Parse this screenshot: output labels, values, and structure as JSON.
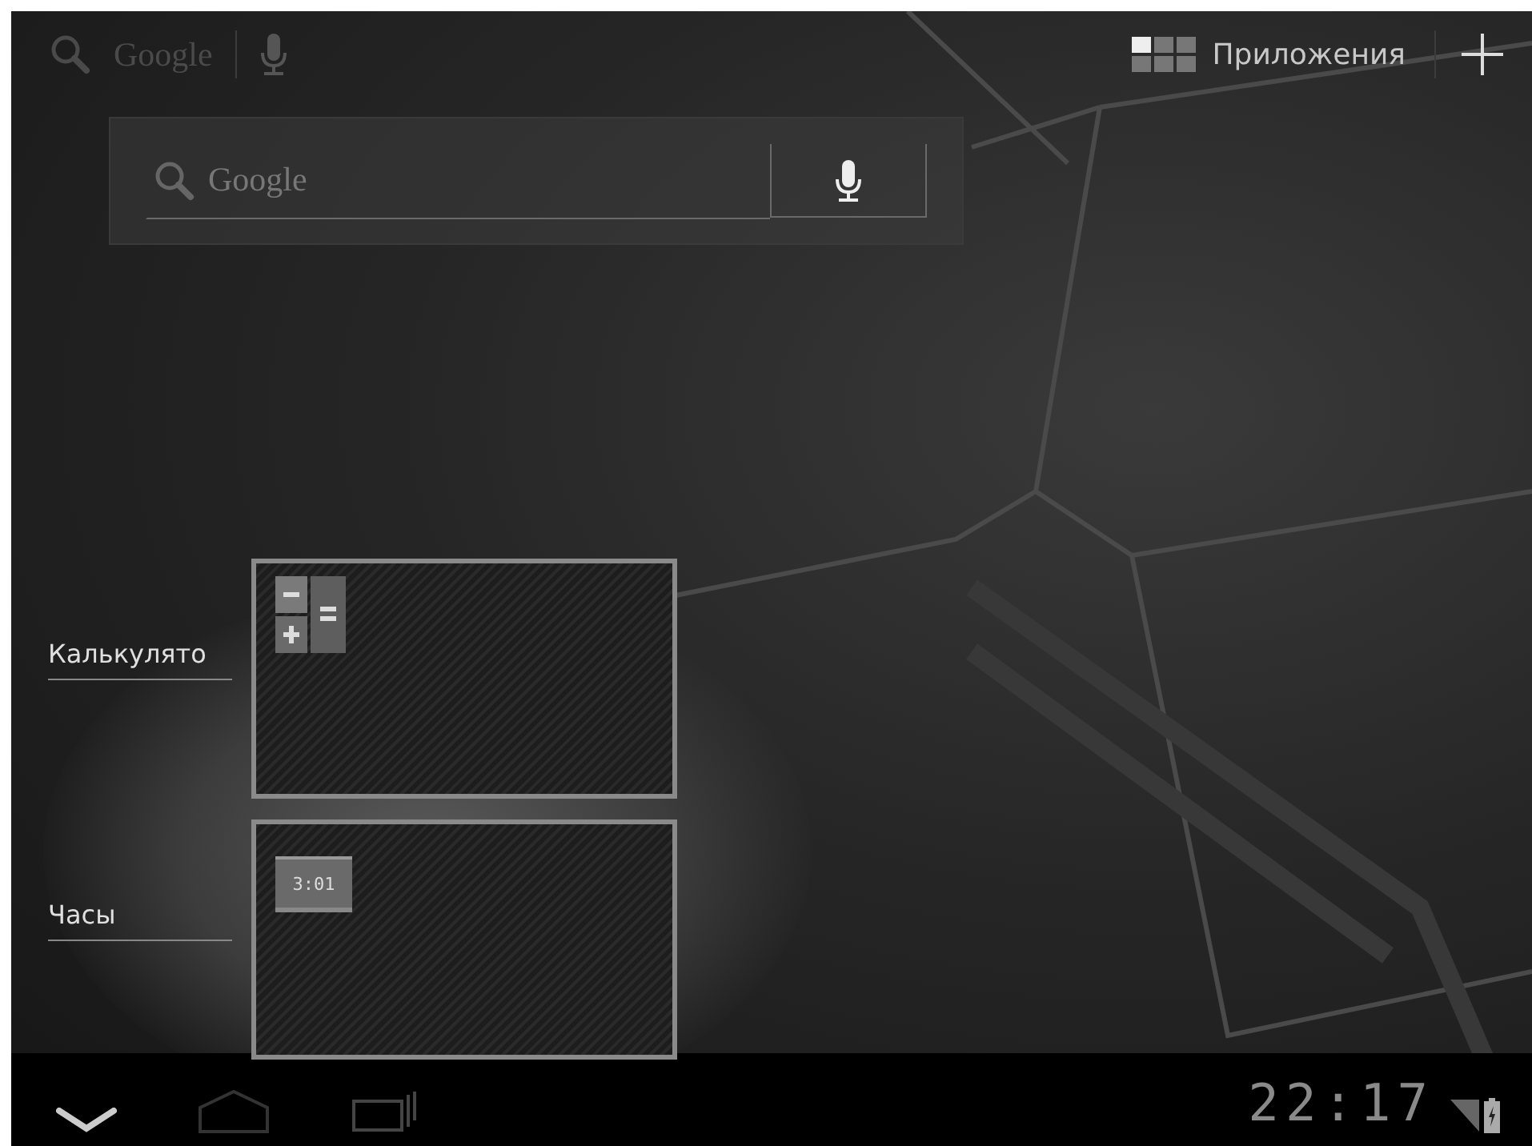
{
  "top_bar": {
    "search_label": "Google",
    "apps_label": "Приложения"
  },
  "search_widget": {
    "label": "Google"
  },
  "recent_apps": [
    {
      "label": "Калькулято",
      "kind": "calculator"
    },
    {
      "label": "Часы",
      "kind": "clock",
      "icon_text": "3:01"
    }
  ],
  "system_bar": {
    "time": "22:17"
  }
}
